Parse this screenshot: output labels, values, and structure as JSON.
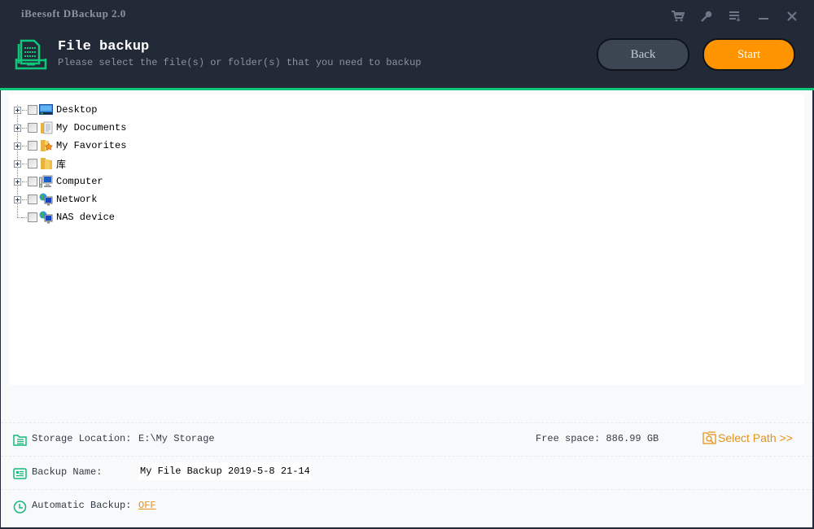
{
  "window": {
    "app_title": "iBeesoft DBackup 2.0",
    "title_icons": [
      "cart-icon",
      "key-icon",
      "menu-icon",
      "minimize-icon",
      "close-icon"
    ]
  },
  "header": {
    "title": "File backup",
    "subtitle": "Please select the file(s) or folder(s) that you need to backup",
    "back_label": "Back",
    "start_label": "Start"
  },
  "colors": {
    "accent_green": "#0ec77b",
    "start_orange": "#fd9400",
    "link_orange": "#e3921a",
    "background_dark": "#222a37"
  },
  "tree": {
    "items": [
      {
        "label": "Desktop",
        "icon": "desktop-icon",
        "expandable": true,
        "checked": false
      },
      {
        "label": "My Documents",
        "icon": "documents-folder-icon",
        "expandable": true,
        "checked": false
      },
      {
        "label": "My Favorites",
        "icon": "favorites-folder-icon",
        "expandable": true,
        "checked": false
      },
      {
        "label": "库",
        "icon": "library-folder-icon",
        "expandable": true,
        "checked": false
      },
      {
        "label": "Computer",
        "icon": "computer-icon",
        "expandable": true,
        "checked": false
      },
      {
        "label": "Network",
        "icon": "network-icon",
        "expandable": true,
        "checked": false
      },
      {
        "label": "NAS device",
        "icon": "network-icon",
        "expandable": false,
        "checked": false
      }
    ]
  },
  "settings": {
    "storage_label": "Storage Location:",
    "storage_value": "E:\\My Storage",
    "free_space": "Free space: 886.99 GB",
    "select_path": "Select Path >>",
    "backup_name_label": "Backup Name:",
    "backup_name_value": "My File Backup 2019-5-8 21-14",
    "auto_backup_label": "Automatic Backup:",
    "auto_backup_value": "OFF"
  }
}
